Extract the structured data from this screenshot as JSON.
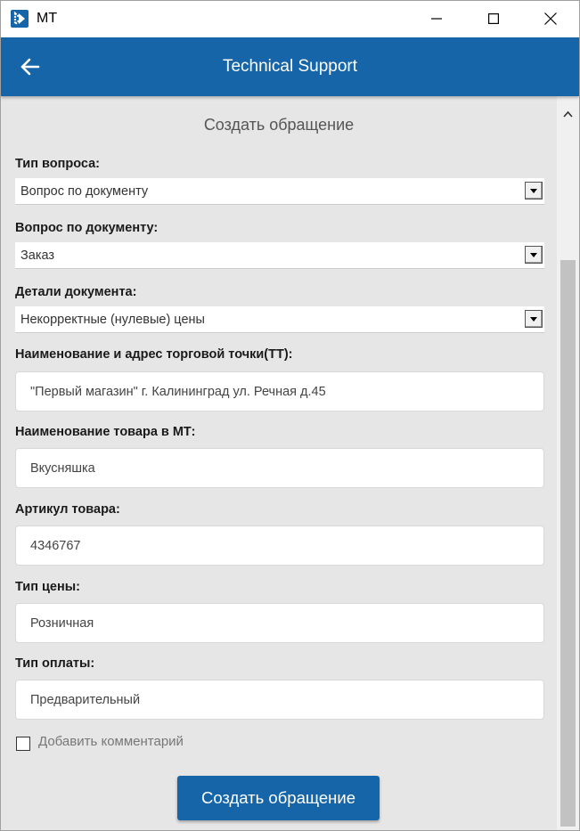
{
  "window": {
    "title": "MT"
  },
  "appbar": {
    "title": "Technical Support"
  },
  "form": {
    "title": "Создать обращение",
    "question_type": {
      "label": "Тип вопроса:",
      "value": "Вопрос по документу"
    },
    "document_question": {
      "label": "Вопрос по документу:",
      "value": "Заказ"
    },
    "document_details": {
      "label": "Детали документа:",
      "value": "Некорректные (нулевые) цены"
    },
    "store_name_address": {
      "label": "Наименование и адрес торговой точки(ТТ):",
      "value": "\"Первый магазин\" г. Калининград ул. Речная д.45"
    },
    "product_name": {
      "label": "Наименование товара в МТ:",
      "value": "Вкусняшка"
    },
    "sku": {
      "label": "Артикул товара:",
      "value": "4346767"
    },
    "price_type": {
      "label": "Тип цены:",
      "value": "Розничная"
    },
    "payment_type": {
      "label": "Тип оплаты:",
      "value": "Предварительный"
    },
    "add_comment": {
      "label": "Добавить комментарий",
      "checked": false
    },
    "submit_label": "Создать обращение"
  },
  "colors": {
    "brand": "#1565a8",
    "background": "#e6e6e6"
  },
  "icons": {
    "app": "app-logo-icon",
    "back": "arrow-left-icon",
    "minimize": "minimize-icon",
    "maximize": "maximize-icon",
    "close": "close-icon",
    "scroll_up": "chevron-up-icon",
    "dropdown": "dropdown-arrow-icon"
  }
}
